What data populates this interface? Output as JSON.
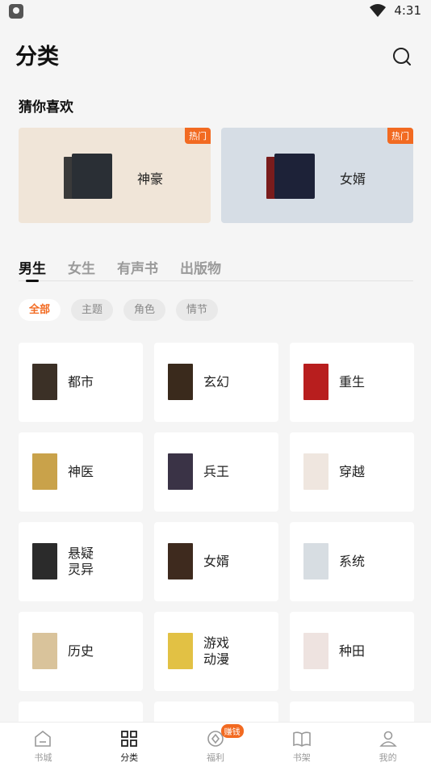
{
  "status": {
    "time": "4:31"
  },
  "header": {
    "title": "分类"
  },
  "recommend": {
    "title": "猜你喜欢",
    "cards": [
      {
        "label": "神豪",
        "badge": "热门",
        "cover_color": "#2a2f35"
      },
      {
        "label": "女婿",
        "badge": "热门",
        "cover_color": "#1d2238"
      }
    ]
  },
  "tabs": [
    {
      "label": "男生",
      "active": true
    },
    {
      "label": "女生",
      "active": false
    },
    {
      "label": "有声书",
      "active": false
    },
    {
      "label": "出版物",
      "active": false
    }
  ],
  "chips": [
    {
      "label": "全部",
      "active": true
    },
    {
      "label": "主题",
      "active": false
    },
    {
      "label": "角色",
      "active": false
    },
    {
      "label": "情节",
      "active": false
    }
  ],
  "categories": [
    {
      "label": "都市",
      "cover_color": "#3b3026"
    },
    {
      "label": "玄幻",
      "cover_color": "#3a2a1c"
    },
    {
      "label": "重生",
      "cover_color": "#b81e1e"
    },
    {
      "label": "神医",
      "cover_color": "#c9a24a"
    },
    {
      "label": "兵王",
      "cover_color": "#3a3346"
    },
    {
      "label": "穿越",
      "cover_color": "#efe6df"
    },
    {
      "label": "悬疑\n灵异",
      "cover_color": "#2b2b2b"
    },
    {
      "label": "女婿",
      "cover_color": "#3e2a1e"
    },
    {
      "label": "系统",
      "cover_color": "#d7dde2"
    },
    {
      "label": "历史",
      "cover_color": "#d9c39b"
    },
    {
      "label": "游戏\n动漫",
      "cover_color": "#e2c144"
    },
    {
      "label": "种田",
      "cover_color": "#eee3e0"
    }
  ],
  "bottom_nav": [
    {
      "label": "书城",
      "icon": "home-icon",
      "active": false
    },
    {
      "label": "分类",
      "icon": "grid-icon",
      "active": true
    },
    {
      "label": "福利",
      "icon": "coin-icon",
      "active": false,
      "badge": "赚钱"
    },
    {
      "label": "书架",
      "icon": "book-icon",
      "active": false
    },
    {
      "label": "我的",
      "icon": "person-icon",
      "active": false
    }
  ],
  "colors": {
    "accent": "#f26a21",
    "background": "#f5f5f5"
  }
}
